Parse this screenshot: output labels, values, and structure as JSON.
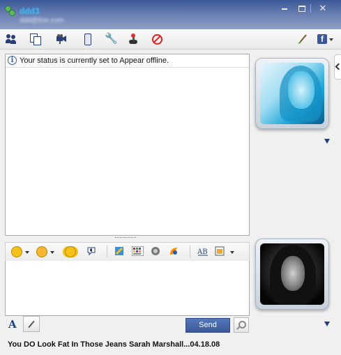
{
  "window": {
    "contact_name": "ddd3",
    "contact_email": "ddd@live.com",
    "minimize_icon": "minimize-icon",
    "maximize_icon": "maximize-icon",
    "close_icon": "close-icon"
  },
  "toolbar": {
    "icons": [
      "contacts-icon",
      "share-files-icon",
      "video-call-icon",
      "phone-icon",
      "activities-icon",
      "games-icon",
      "block-icon"
    ],
    "right_icons": [
      "theme-brush-icon",
      "facebook-icon"
    ]
  },
  "conversation": {
    "status_message": "Your status is currently set to Appear offline."
  },
  "compose": {
    "format_icons": [
      "emoticon-icon",
      "wink-icon",
      "nudge-icon",
      "voice-clip-icon",
      "ink-icon",
      "background-icon",
      "games-icon",
      "winks-icon",
      "spell-check-icon",
      "send-file-icon"
    ],
    "send_label": "Send"
  },
  "footer": {
    "personal_message": "You DO Look Fat In Those Jeans Sarah Marshall...04.18.08"
  },
  "colors": {
    "accent": "#3b5998",
    "block_red": "#e02020"
  }
}
